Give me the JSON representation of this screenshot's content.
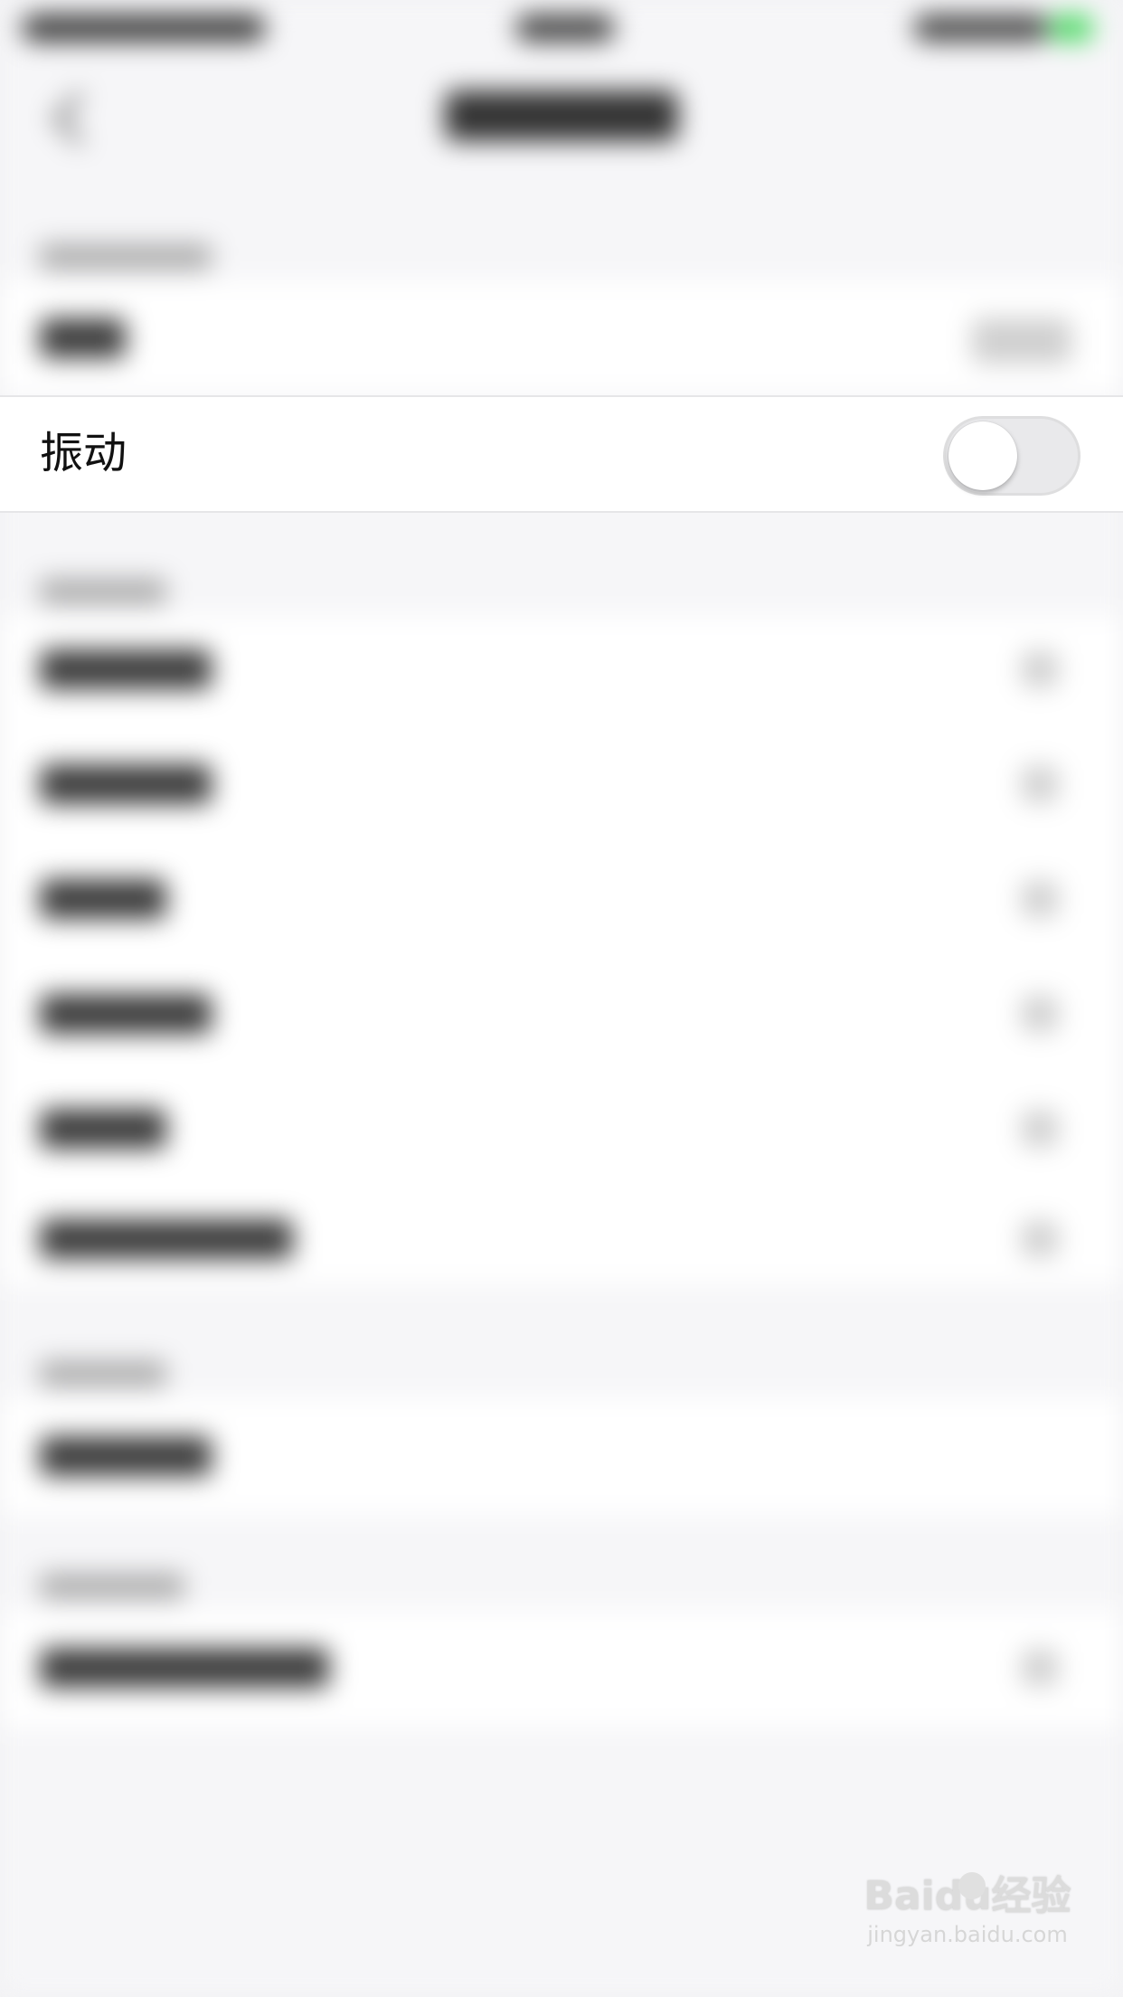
{
  "vibration_row": {
    "label": "振动",
    "toggle_on": false
  },
  "watermark": {
    "logo": "Baidu经验",
    "url": "jingyan.baidu.com"
  },
  "colors": {
    "toggle_off_track": "#e9e9eb",
    "toggle_knob": "#ffffff",
    "battery_green": "#4cd964"
  }
}
